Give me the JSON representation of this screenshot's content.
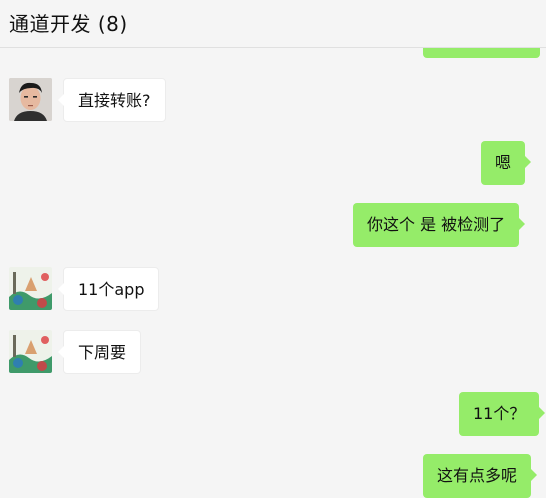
{
  "header": {
    "title": "通道开发 (8)"
  },
  "messages": [
    {
      "side": "in",
      "avatar": "avatar-person-icon",
      "text": "直接转账?"
    },
    {
      "side": "out",
      "text": "嗯"
    },
    {
      "side": "out",
      "text": "你这个 是 被检测了"
    },
    {
      "side": "in",
      "avatar": "avatar-landscape-icon",
      "text": "11个app"
    },
    {
      "side": "in",
      "avatar": "avatar-landscape-icon",
      "text": "下周要"
    },
    {
      "side": "out",
      "text": "11个？"
    },
    {
      "side": "out",
      "text": "这有点多呢"
    }
  ],
  "colors": {
    "outgoing_bubble": "#95ec69",
    "incoming_bubble": "#ffffff",
    "background": "#f5f5f5"
  }
}
